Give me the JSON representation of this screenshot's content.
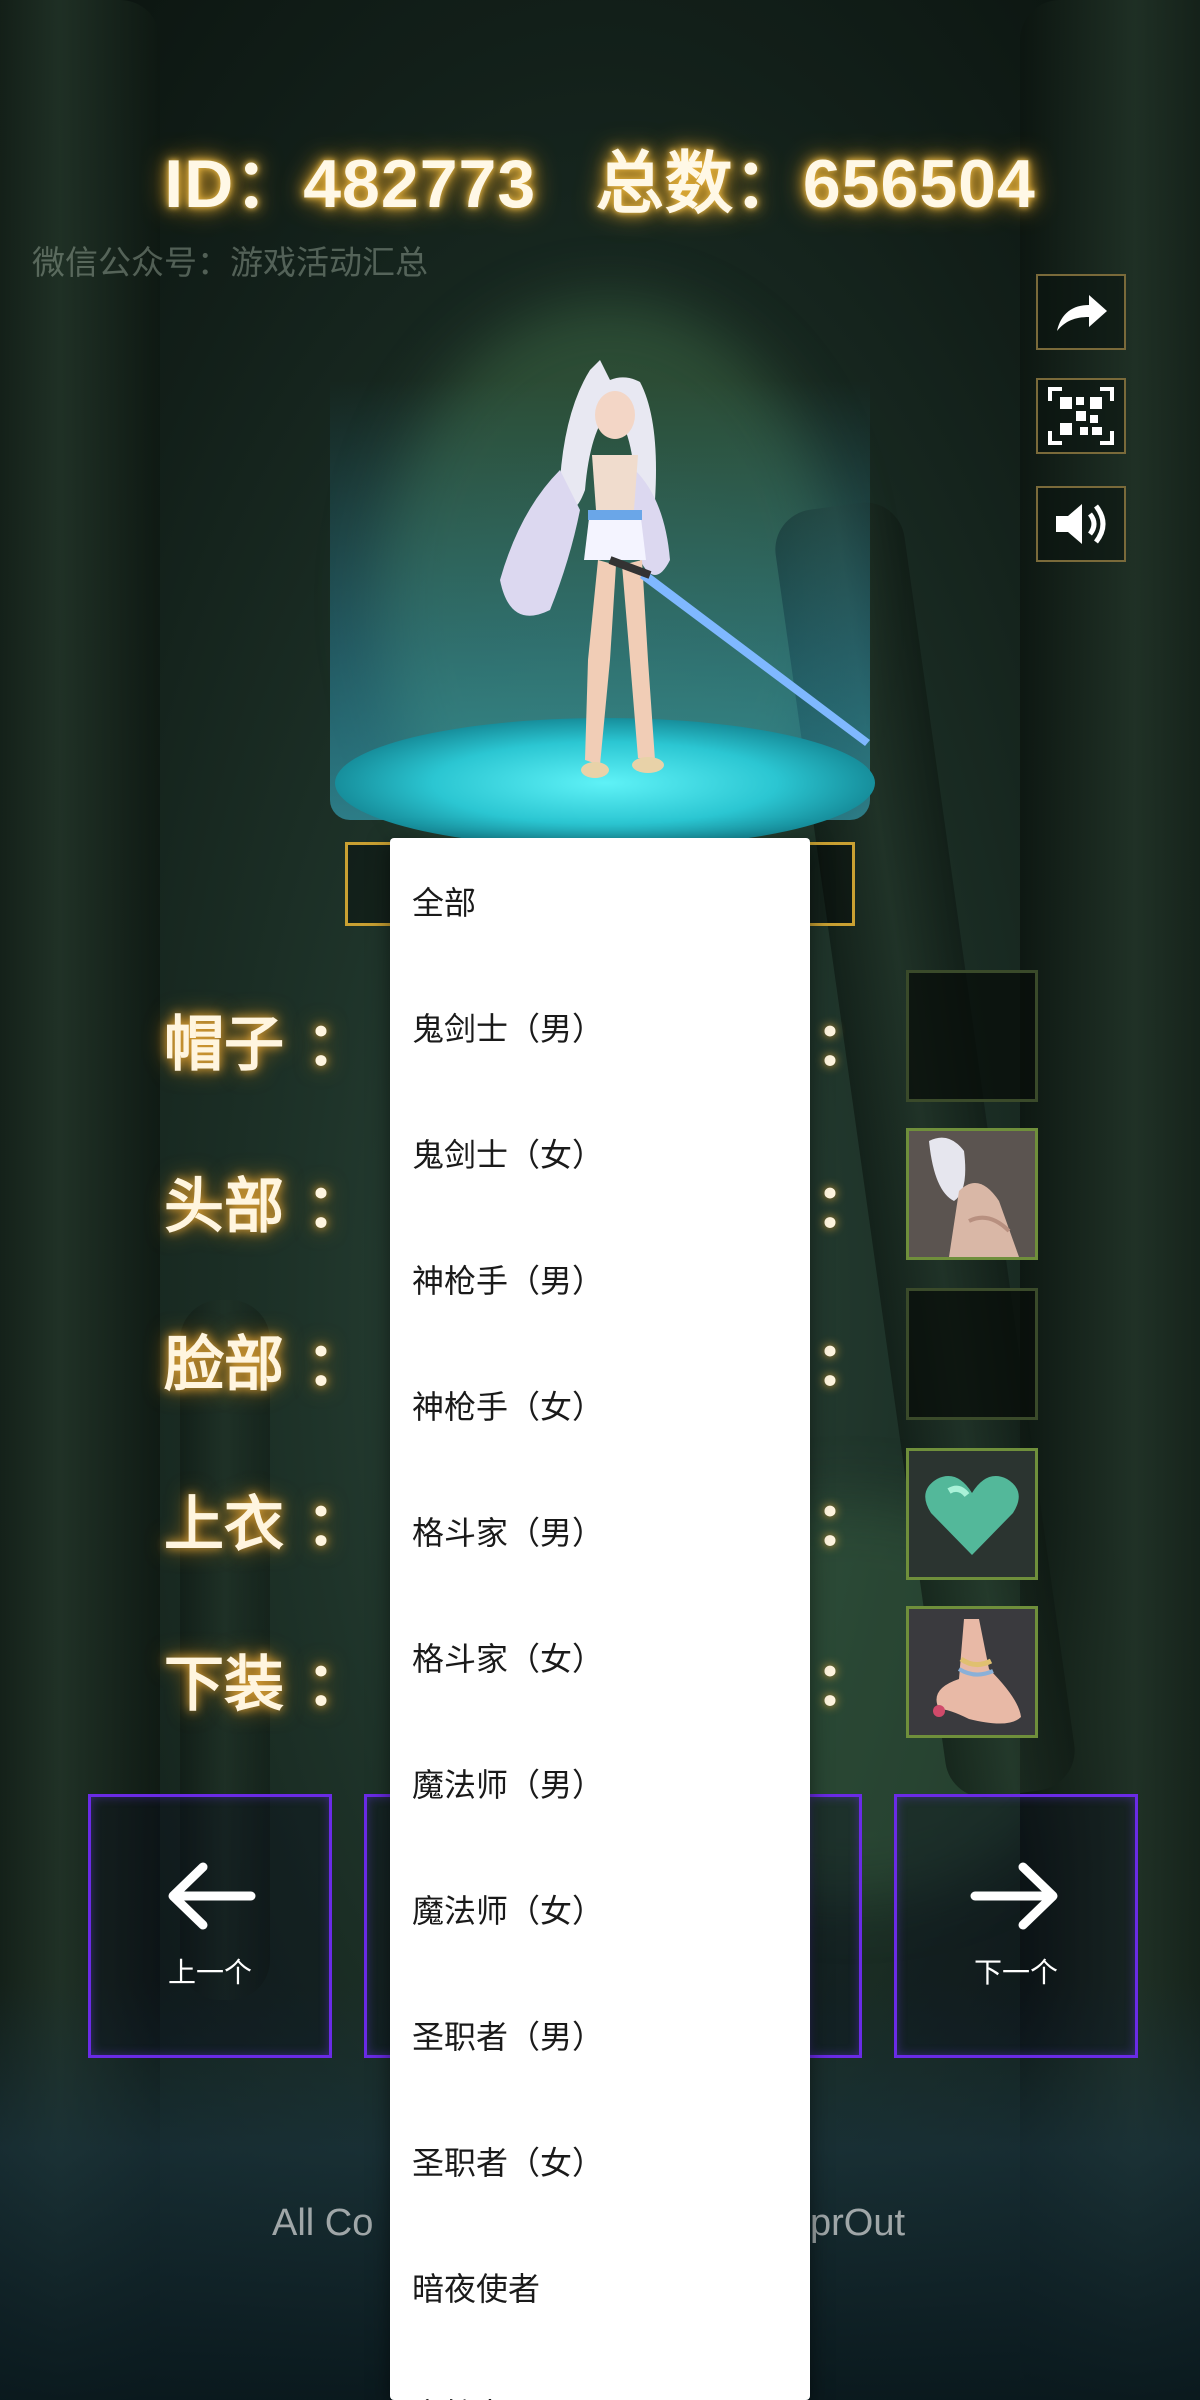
{
  "header": {
    "id_label": "ID：",
    "id_value": "482773",
    "total_label": "总数：",
    "total_value": "656504",
    "watermark": "微信公众号：游戏活动汇总"
  },
  "side_buttons": [
    {
      "icon": "share-icon"
    },
    {
      "icon": "qr-code-icon"
    },
    {
      "icon": "volume-icon"
    }
  ],
  "equipment": [
    {
      "label": "帽子",
      "colon": "：",
      "slot_icon": "empty-slot"
    },
    {
      "label": "头部",
      "colon": "：",
      "slot_icon": "white-hair-head-icon"
    },
    {
      "label": "脸部",
      "colon": "：",
      "slot_icon": "empty-slot"
    },
    {
      "label": "上衣",
      "colon": "：",
      "slot_icon": "green-heart-icon"
    },
    {
      "label": "下装",
      "colon": "：",
      "slot_icon": "anklet-foot-icon"
    }
  ],
  "nav": {
    "prev_label": "上一个",
    "next_label": "下一个"
  },
  "footer": {
    "left_fragment": "All Co",
    "right_fragment": "prOut"
  },
  "dropdown": {
    "options": [
      "全部",
      "鬼剑士（男）",
      "鬼剑士（女）",
      "神枪手（男）",
      "神枪手（女）",
      "格斗家（男）",
      "格斗家（女）",
      "魔法师（男）",
      "魔法师（女）",
      "圣职者（男）",
      "圣职者（女）",
      "暗夜使者",
      "守护者"
    ]
  },
  "colors": {
    "glow_gold": "#e6b23a",
    "nav_border": "#6a2be6",
    "platform_cyan": "#2bc6d2",
    "frame_gold": "#c9a032"
  }
}
